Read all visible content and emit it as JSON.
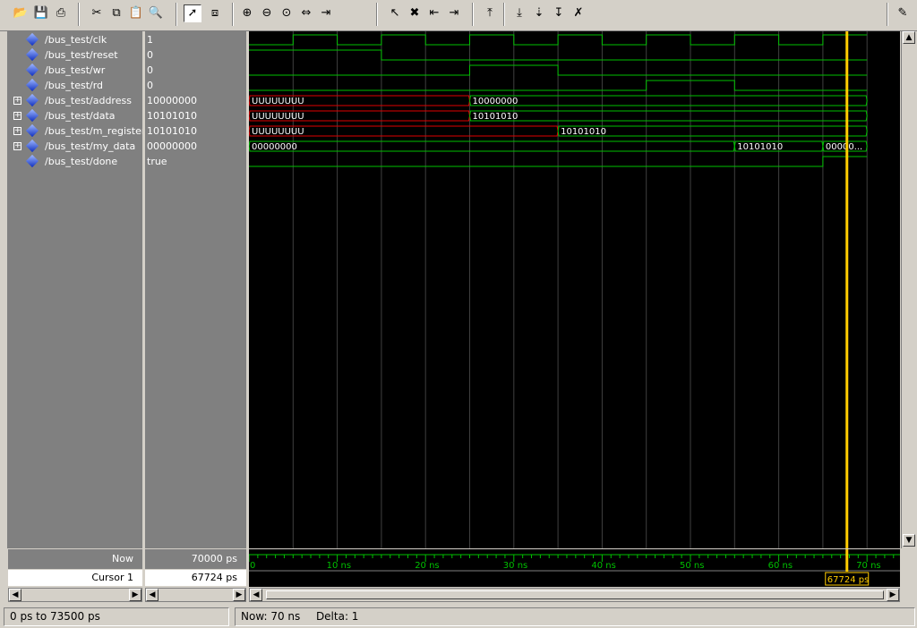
{
  "toolbar": {
    "icons": [
      "open-icon",
      "save-icon",
      "print-icon",
      "cut-icon",
      "copy-icon",
      "paste-icon",
      "find-icon",
      "select-mode-icon",
      "zoom-mode-icon",
      "zoom-in-icon",
      "zoom-out-icon",
      "zoom-full-icon",
      "zoom-range-icon",
      "zoom-cursor-icon",
      "insert-cursor-icon",
      "delete-cursor-icon",
      "prev-edge-icon",
      "next-edge-icon",
      "find-first-icon",
      "find-prev-icon",
      "find-next-icon",
      "find-last-icon",
      "clear-icon",
      "dock-icon"
    ]
  },
  "signals": [
    {
      "name": "/bus_test/clk",
      "value": "1",
      "expandable": false
    },
    {
      "name": "/bus_test/reset",
      "value": "0",
      "expandable": false
    },
    {
      "name": "/bus_test/wr",
      "value": "0",
      "expandable": false
    },
    {
      "name": "/bus_test/rd",
      "value": "0",
      "expandable": false
    },
    {
      "name": "/bus_test/address",
      "value": "10000000",
      "expandable": true
    },
    {
      "name": "/bus_test/data",
      "value": "10101010",
      "expandable": true
    },
    {
      "name": "/bus_test/m_register",
      "value": "10101010",
      "expandable": true
    },
    {
      "name": "/bus_test/my_data",
      "value": "00000000",
      "expandable": true
    },
    {
      "name": "/bus_test/done",
      "value": "true",
      "expandable": false
    }
  ],
  "bus_labels": {
    "address": [
      "UUUUUUUU",
      "10000000"
    ],
    "data": [
      "UUUUUUUU",
      "10101010"
    ],
    "m_register": [
      "UUUUUUUU",
      "10101010"
    ],
    "my_data": [
      "00000000",
      "10101010",
      "00000..."
    ]
  },
  "now": {
    "label": "Now",
    "value": "70000 ps"
  },
  "cursor": {
    "label": "Cursor 1",
    "value": "67724 ps",
    "marker": "67724 ps"
  },
  "timeline": {
    "ticks": [
      "0",
      "10 ns",
      "20 ns",
      "30 ns",
      "40 ns",
      "50 ns",
      "60 ns",
      "70 ns"
    ]
  },
  "status": {
    "range": "0 ps to 73500 ps",
    "now": "Now: 70 ns",
    "delta": "Delta: 1"
  },
  "colors": {
    "wave": "#00c000",
    "undefined": "#e00000",
    "bus_text": "#ffffff",
    "cursor": "#ffcc00",
    "grid": "#404040"
  }
}
